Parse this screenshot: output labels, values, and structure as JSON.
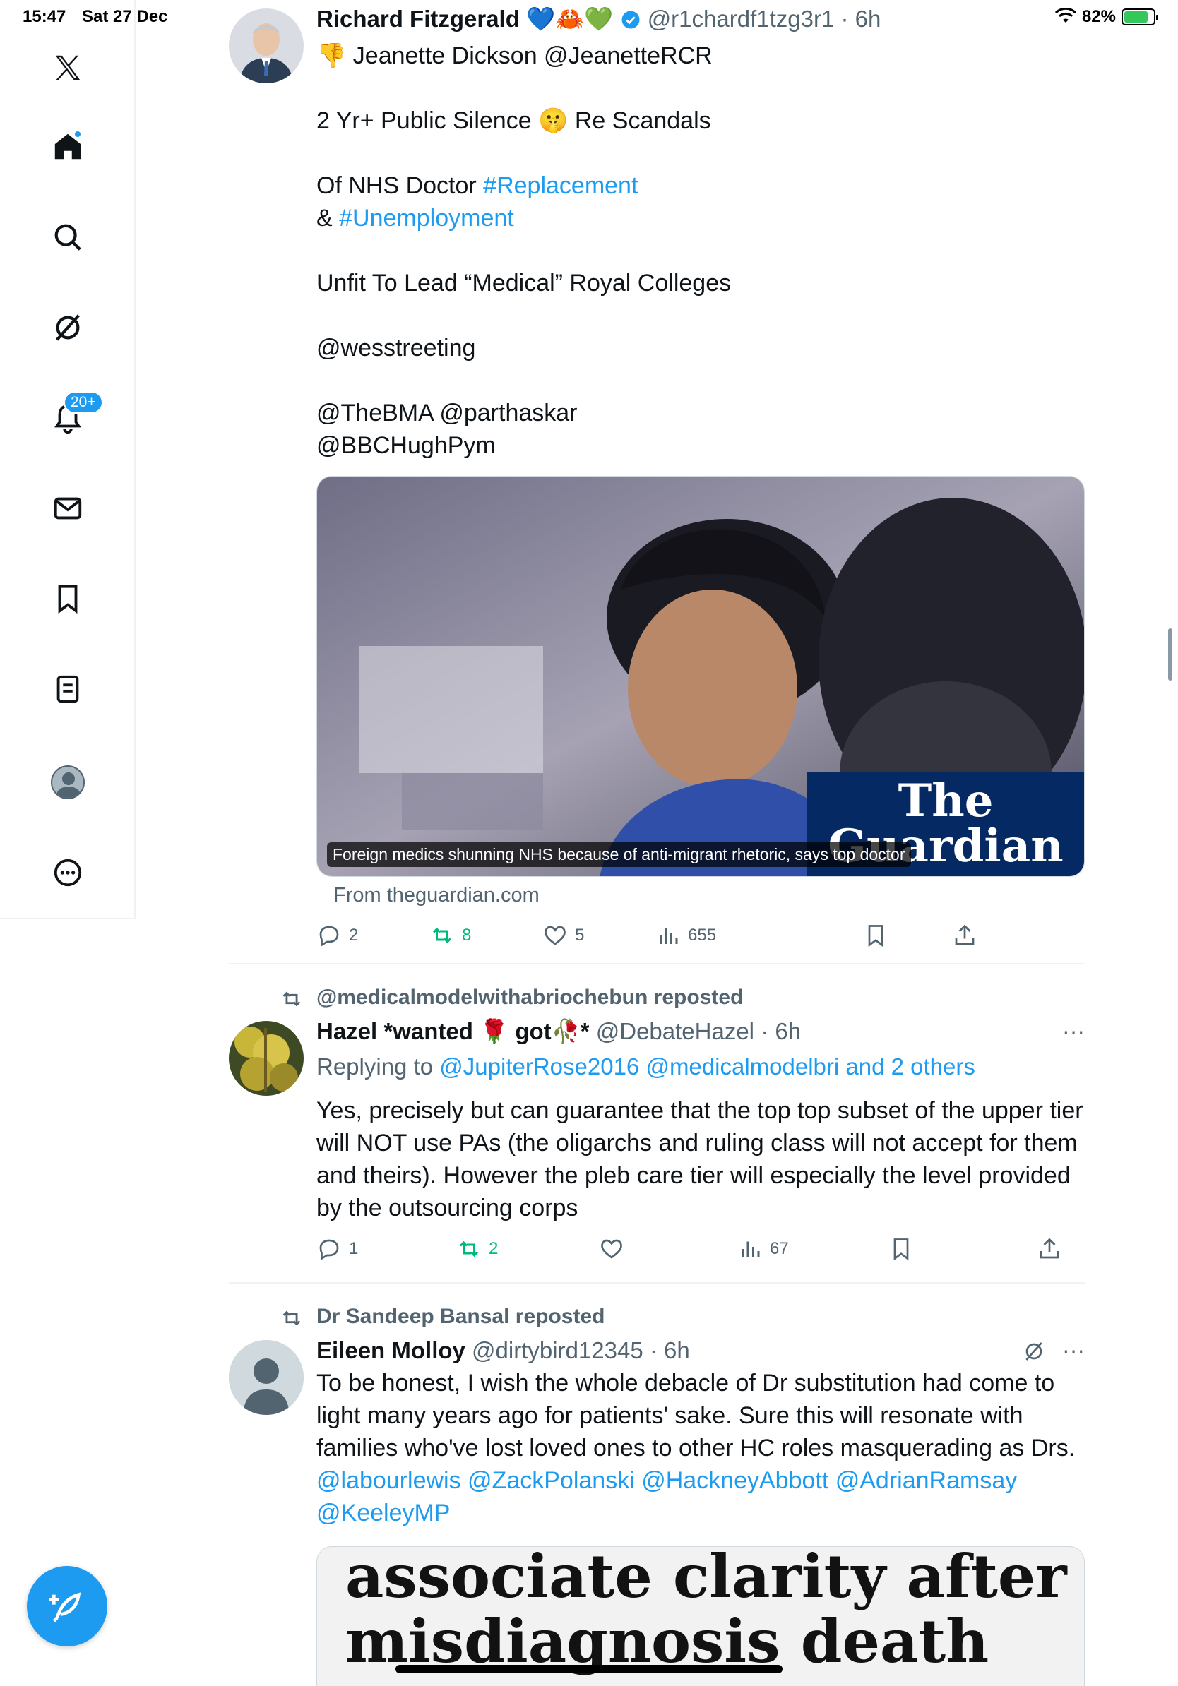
{
  "status_bar": {
    "time": "15:47",
    "date": "Sat 27 Dec",
    "battery": "82%",
    "battery_level": 0.82
  },
  "sidebar": {
    "notifications_badge": "20+",
    "items": [
      "x-logo-icon",
      "home-icon",
      "search-icon",
      "grok-icon",
      "notifications-icon",
      "messages-icon",
      "bookmarks-icon",
      "lists-icon",
      "profile-icon",
      "more-icon"
    ]
  },
  "tweets": [
    {
      "name": "Richard Fitzgerald",
      "name_emojis": "💙🦀💚",
      "handle": "@r1chardf1tzg3r1",
      "time": "· 6h",
      "line1_emoji": "👎",
      "line1": "Jeanette Dickson @JeanetteRCR",
      "line2": "2 Yr+ Public Silence",
      "line2_emoji": "🤫",
      "line2b": "Re Scandals",
      "line3": "Of NHS Doctor",
      "tag1": "#Replacement",
      "line4": "&",
      "tag2": "#Unemployment",
      "line5": "Unfit To Lead “Medical” Royal Colleges",
      "line6": "@wesstreeting",
      "line7": "@TheBMA @parthaskar",
      "line8": "@BBCHughPym",
      "card": {
        "caption": "Foreign medics shunning NHS because of anti-migrant rhetoric, says top doctor",
        "brand_line1": "The",
        "brand_line2": "Guardian",
        "source": "From theguardian.com"
      },
      "replies": "2",
      "reposts": "8",
      "likes": "5",
      "views": "655"
    },
    {
      "repost_by": "@medicalmodelwithabriochebun reposted",
      "name": "Hazel *wanted 🌹 got🥀*",
      "handle": "@DebateHazel",
      "time": "· 6h",
      "replying_prefix": "Replying to",
      "replying_to": "@JupiterRose2016 @medicalmodelbri and 2 others",
      "text": "Yes, precisely but can guarantee that the top top subset of the upper tier will NOT use PAs (the oligarchs and ruling class will not accept for them and theirs). However the pleb care tier will especially the level provided by the outsourcing corps",
      "replies": "1",
      "reposts": "2",
      "views": "67"
    },
    {
      "repost_by": "Dr Sandeep Bansal reposted",
      "name": "Eileen Molloy",
      "handle": "@dirtybird12345",
      "time": "· 6h",
      "text": "To be honest, I wish the whole debacle of Dr substitution had come to light many years ago for patients' sake. Sure this will resonate with families who've lost loved ones to other HC roles masquerading as Drs.",
      "mentions1": "@labourlewis @ZackPolanski @HackneyAbbott @AdrianRamsay",
      "mentions2": "@KeeleyMP",
      "media_text1": "associate clarity after",
      "media_text2": "misdiagnosis death"
    }
  ],
  "colors": {
    "accent": "#1d9bf0",
    "repost_green": "#00ba7c",
    "muted": "#536471",
    "guardian_navy": "#052962"
  }
}
